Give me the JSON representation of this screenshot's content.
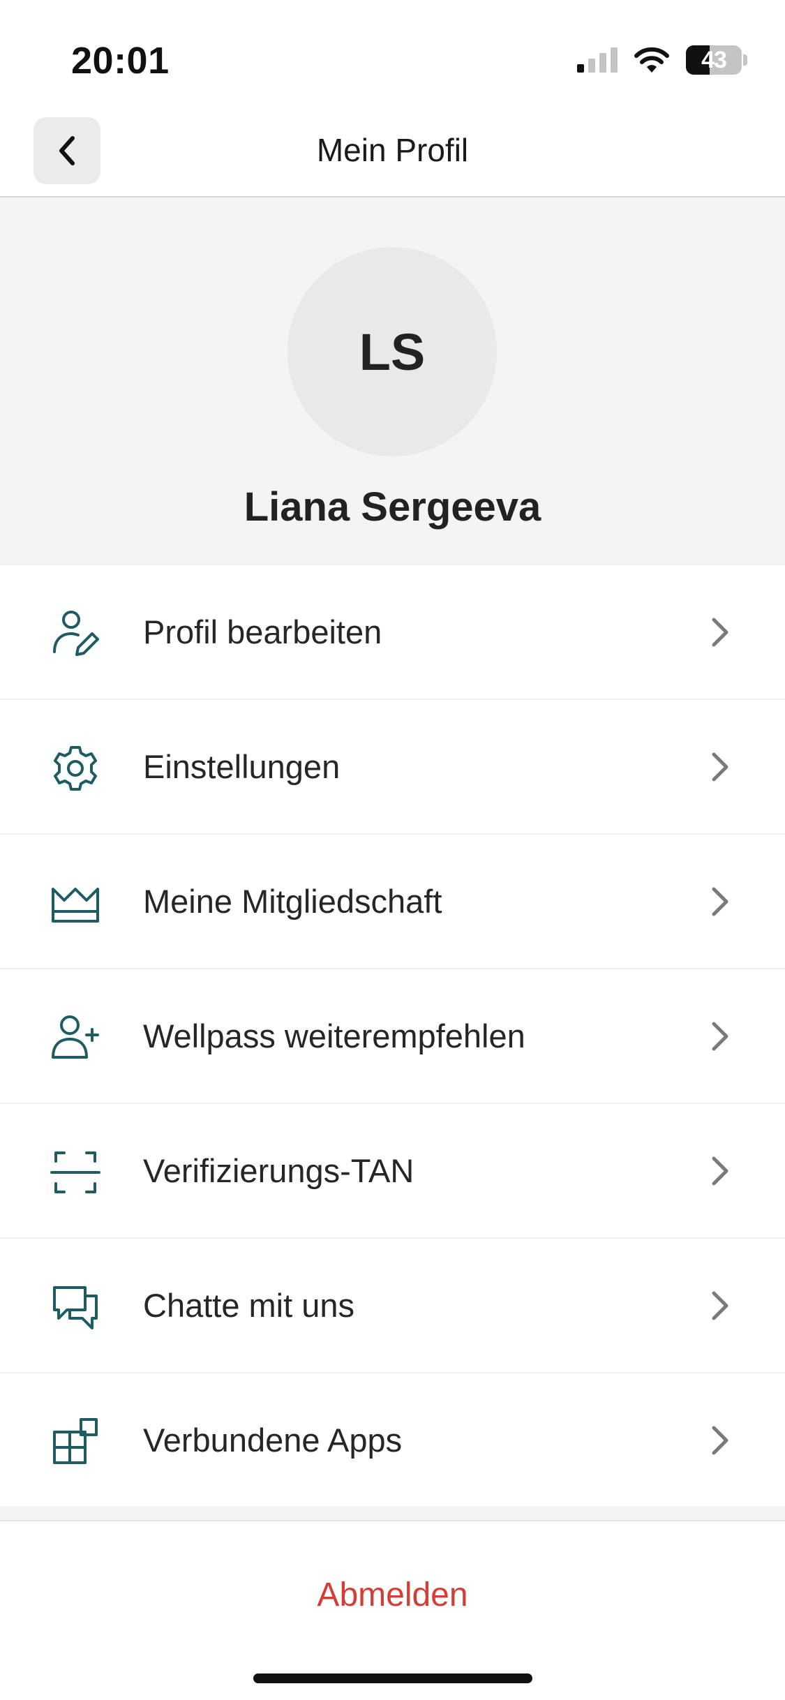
{
  "status_bar": {
    "time": "20:01",
    "battery_level": "43",
    "battery_fraction": 0.43,
    "signal_bars_active": 1,
    "signal_bars_total": 4
  },
  "nav": {
    "title": "Mein Profil",
    "back_icon": "chevron-left-icon"
  },
  "profile": {
    "initials": "LS",
    "name": "Liana Sergeeva"
  },
  "menu": {
    "items": [
      {
        "label": "Profil bearbeiten",
        "icon": "user-edit-icon"
      },
      {
        "label": "Einstellungen",
        "icon": "gear-icon"
      },
      {
        "label": "Meine Mitgliedschaft",
        "icon": "crown-icon"
      },
      {
        "label": "Wellpass weiterempfehlen",
        "icon": "user-add-icon"
      },
      {
        "label": "Verifizierungs-TAN",
        "icon": "scan-frame-icon"
      },
      {
        "label": "Chatte mit uns",
        "icon": "chat-bubbles-icon"
      },
      {
        "label": "Verbundene Apps",
        "icon": "apps-grid-icon"
      }
    ]
  },
  "footer": {
    "logout_label": "Abmelden"
  },
  "colors": {
    "icon_teal": "#1d5c63",
    "logout_red": "#d33d35",
    "header_background": "#f5f4f2",
    "chevron_gray": "#7a7a7a"
  }
}
